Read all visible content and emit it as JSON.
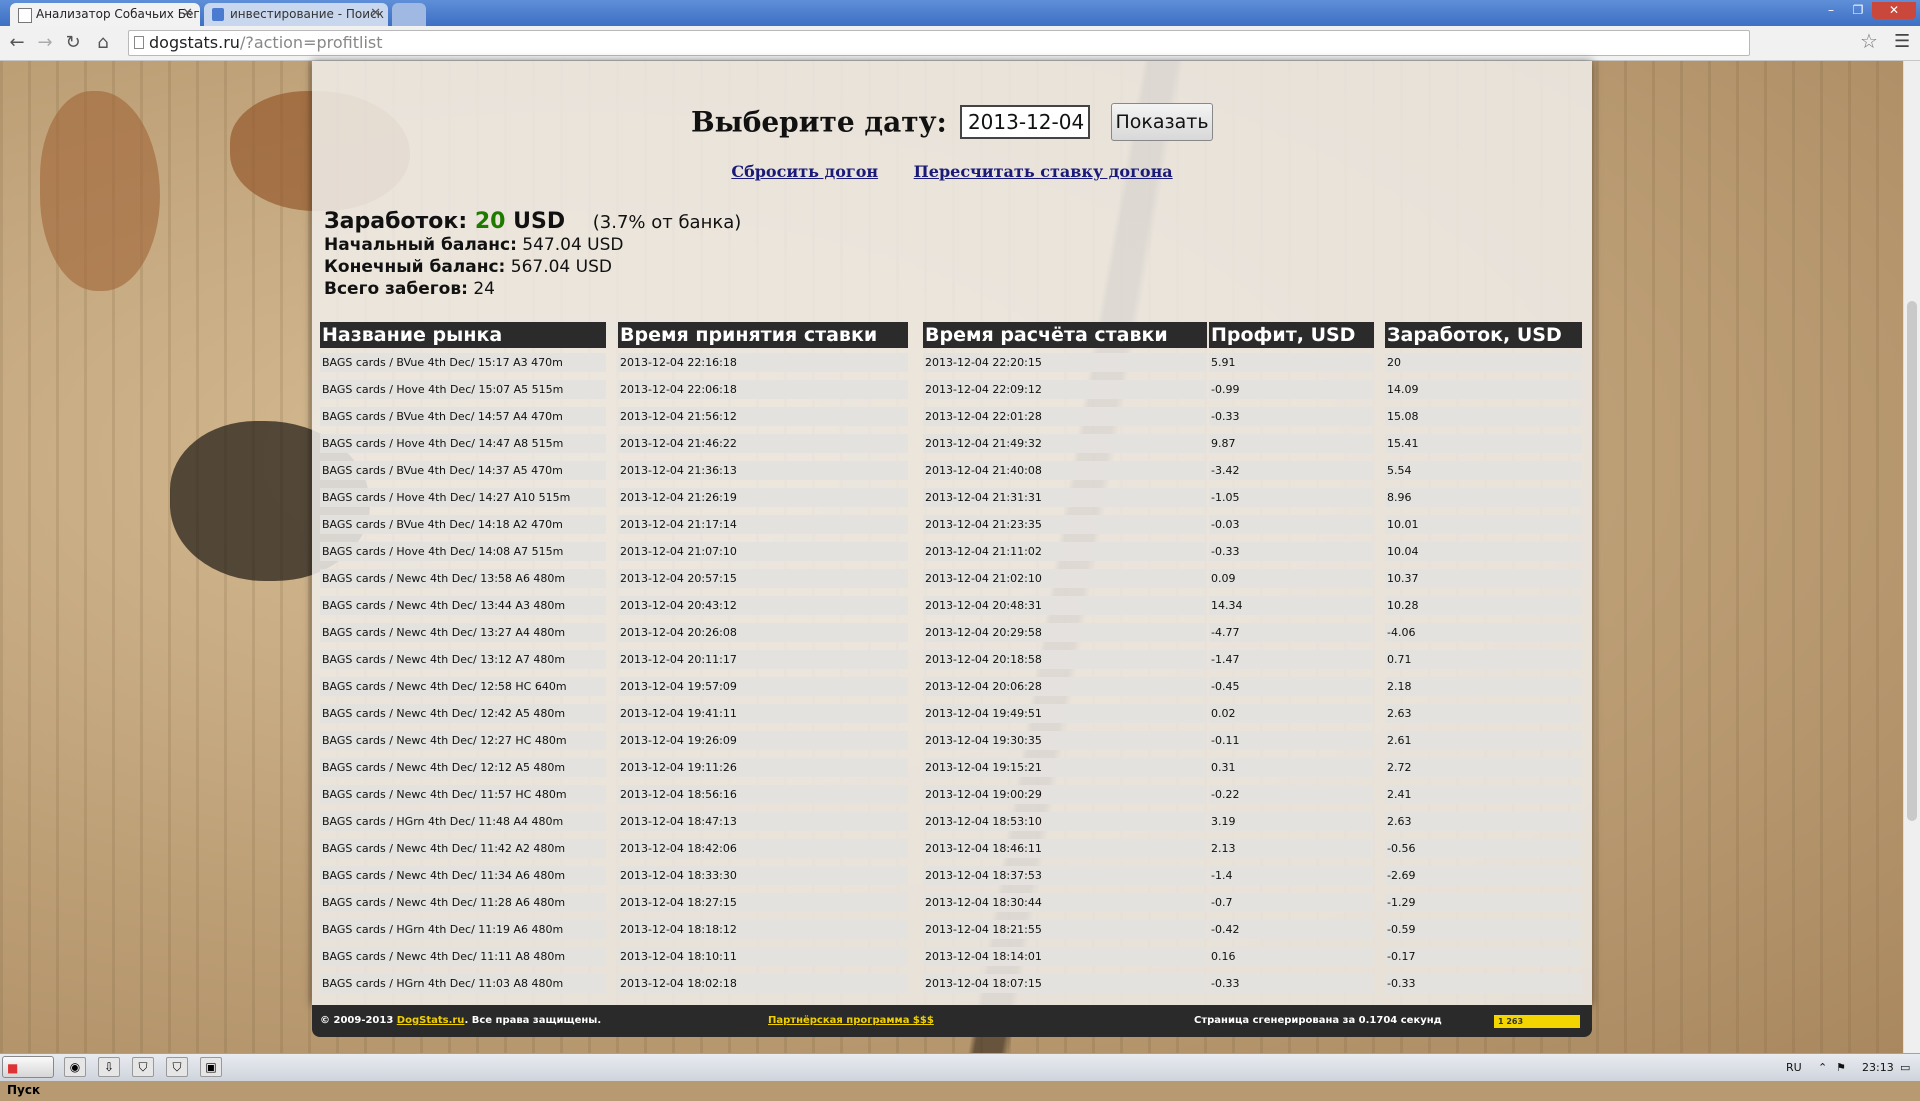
{
  "browser": {
    "tabs": [
      {
        "title": "Анализатор Собачьих Бегов",
        "active": true
      },
      {
        "title": "инвестирование - Поиск в Google",
        "active": false
      }
    ],
    "address": {
      "host": "dogstats.ru",
      "path": "/?action=profitlist"
    }
  },
  "page": {
    "date_label": "Выберите дату:",
    "date_value": "2013-12-04",
    "show_button": "Показать",
    "links": {
      "reset": "Сбросить догон",
      "recalc": "Пересчитать ставку догона"
    },
    "summary": {
      "earnings_label": "Заработок:",
      "earnings_value": "20",
      "earnings_currency": "USD",
      "earnings_pct": "(3.7% от банка)",
      "start_balance_label": "Начальный баланс:",
      "start_balance_value": "547.04 USD",
      "end_balance_label": "Конечный баланс:",
      "end_balance_value": "567.04 USD",
      "races_label": "Всего забегов:",
      "races_value": "24"
    },
    "table": {
      "headers": [
        "Название рынка",
        "Время принятия ставки",
        "Время расчёта ставки",
        "Профит, USD",
        "Заработок, USD"
      ],
      "rows": [
        [
          "BAGS cards / BVue 4th Dec/ 15:17 A3 470m",
          "2013-12-04 22:16:18",
          "2013-12-04 22:20:15",
          "5.91",
          "20"
        ],
        [
          "BAGS cards / Hove 4th Dec/ 15:07 A5 515m",
          "2013-12-04 22:06:18",
          "2013-12-04 22:09:12",
          "-0.99",
          "14.09"
        ],
        [
          "BAGS cards / BVue 4th Dec/ 14:57 A4 470m",
          "2013-12-04 21:56:12",
          "2013-12-04 22:01:28",
          "-0.33",
          "15.08"
        ],
        [
          "BAGS cards / Hove 4th Dec/ 14:47 A8 515m",
          "2013-12-04 21:46:22",
          "2013-12-04 21:49:32",
          "9.87",
          "15.41"
        ],
        [
          "BAGS cards / BVue 4th Dec/ 14:37 A5 470m",
          "2013-12-04 21:36:13",
          "2013-12-04 21:40:08",
          "-3.42",
          "5.54"
        ],
        [
          "BAGS cards / Hove 4th Dec/ 14:27 A10 515m",
          "2013-12-04 21:26:19",
          "2013-12-04 21:31:31",
          "-1.05",
          "8.96"
        ],
        [
          "BAGS cards / BVue 4th Dec/ 14:18 A2 470m",
          "2013-12-04 21:17:14",
          "2013-12-04 21:23:35",
          "-0.03",
          "10.01"
        ],
        [
          "BAGS cards / Hove 4th Dec/ 14:08 A7 515m",
          "2013-12-04 21:07:10",
          "2013-12-04 21:11:02",
          "-0.33",
          "10.04"
        ],
        [
          "BAGS cards / Newc 4th Dec/ 13:58 A6 480m",
          "2013-12-04 20:57:15",
          "2013-12-04 21:02:10",
          "0.09",
          "10.37"
        ],
        [
          "BAGS cards / Newc 4th Dec/ 13:44 A3 480m",
          "2013-12-04 20:43:12",
          "2013-12-04 20:48:31",
          "14.34",
          "10.28"
        ],
        [
          "BAGS cards / Newc 4th Dec/ 13:27 A4 480m",
          "2013-12-04 20:26:08",
          "2013-12-04 20:29:58",
          "-4.77",
          "-4.06"
        ],
        [
          "BAGS cards / Newc 4th Dec/ 13:12 A7 480m",
          "2013-12-04 20:11:17",
          "2013-12-04 20:18:58",
          "-1.47",
          "0.71"
        ],
        [
          "BAGS cards / Newc 4th Dec/ 12:58 HC 640m",
          "2013-12-04 19:57:09",
          "2013-12-04 20:06:28",
          "-0.45",
          "2.18"
        ],
        [
          "BAGS cards / Newc 4th Dec/ 12:42 A5 480m",
          "2013-12-04 19:41:11",
          "2013-12-04 19:49:51",
          "0.02",
          "2.63"
        ],
        [
          "BAGS cards / Newc 4th Dec/ 12:27 HC 480m",
          "2013-12-04 19:26:09",
          "2013-12-04 19:30:35",
          "-0.11",
          "2.61"
        ],
        [
          "BAGS cards / Newc 4th Dec/ 12:12 A5 480m",
          "2013-12-04 19:11:26",
          "2013-12-04 19:15:21",
          "0.31",
          "2.72"
        ],
        [
          "BAGS cards / Newc 4th Dec/ 11:57 HC 480m",
          "2013-12-04 18:56:16",
          "2013-12-04 19:00:29",
          "-0.22",
          "2.41"
        ],
        [
          "BAGS cards / HGrn 4th Dec/ 11:48 A4 480m",
          "2013-12-04 18:47:13",
          "2013-12-04 18:53:10",
          "3.19",
          "2.63"
        ],
        [
          "BAGS cards / Newc 4th Dec/ 11:42 A2 480m",
          "2013-12-04 18:42:06",
          "2013-12-04 18:46:11",
          "2.13",
          "-0.56"
        ],
        [
          "BAGS cards / Newc 4th Dec/ 11:34 A6 480m",
          "2013-12-04 18:33:30",
          "2013-12-04 18:37:53",
          "-1.4",
          "-2.69"
        ],
        [
          "BAGS cards / Newc 4th Dec/ 11:28 A6 480m",
          "2013-12-04 18:27:15",
          "2013-12-04 18:30:44",
          "-0.7",
          "-1.29"
        ],
        [
          "BAGS cards / HGrn 4th Dec/ 11:19 A6 480m",
          "2013-12-04 18:18:12",
          "2013-12-04 18:21:55",
          "-0.42",
          "-0.59"
        ],
        [
          "BAGS cards / Newc 4th Dec/ 11:11 A8 480m",
          "2013-12-04 18:10:11",
          "2013-12-04 18:14:01",
          "0.16",
          "-0.17"
        ],
        [
          "BAGS cards / HGrn 4th Dec/ 11:03 A8 480m",
          "2013-12-04 18:02:18",
          "2013-12-04 18:07:15",
          "-0.33",
          "-0.33"
        ]
      ]
    },
    "footer": {
      "copyright_prefix": "© 2009-2013",
      "site_link": "DogStats.ru",
      "copyright_suffix": ". Все права защищены.",
      "partner_link": "Партнёрская программа $$$",
      "generated": "Страница сгенерирована за 0.1704 секунд",
      "counter": "1 263"
    }
  },
  "taskbar": {
    "start_label": "Пуск",
    "lang": "RU",
    "time": "23:13"
  },
  "colors": {
    "earnings_green": "#1f7a00",
    "header_bg": "#2b2b2b",
    "footer_link": "#f0d000"
  }
}
